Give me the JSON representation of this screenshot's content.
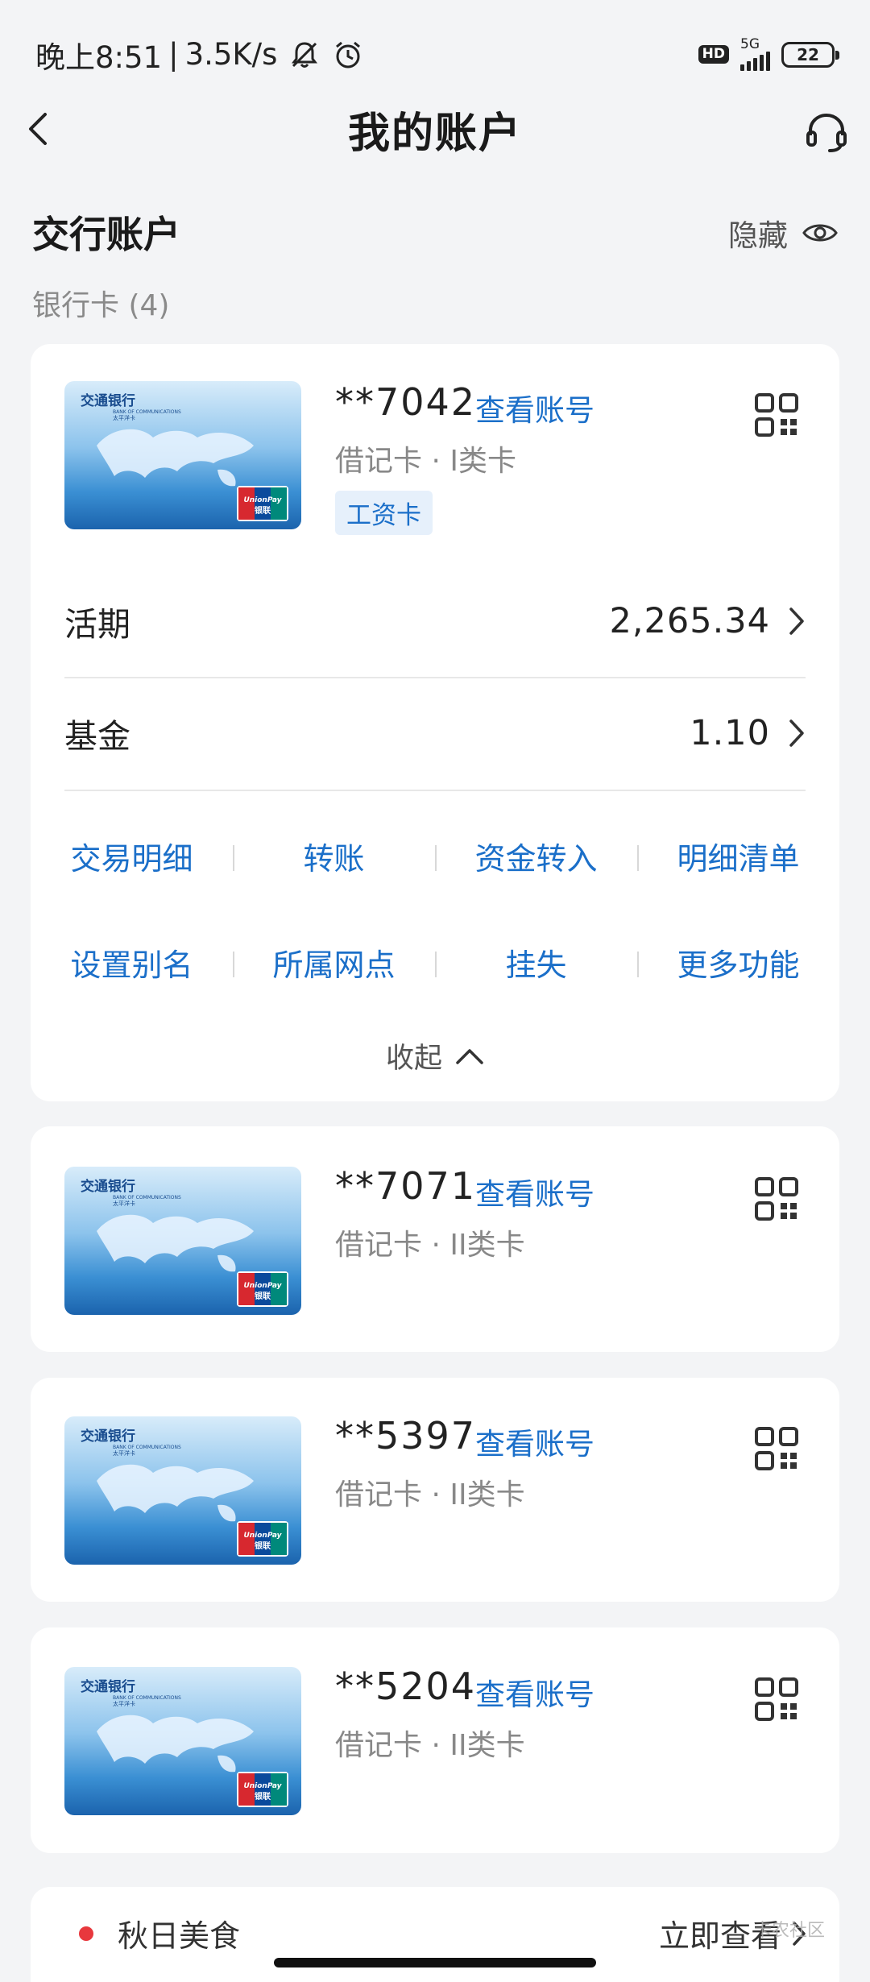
{
  "status_bar": {
    "time": "晚上8:51",
    "speed": "3.5K/s",
    "hd": "HD",
    "network": "5G",
    "battery": "22"
  },
  "header": {
    "title": "我的账户"
  },
  "section": {
    "title": "交行账户",
    "hide_label": "隐藏",
    "card_count": "银行卡 (4)"
  },
  "cards": [
    {
      "number": "**7042",
      "view_label": "查看账号",
      "type": "借记卡 · I类卡",
      "tag": "工资卡",
      "balances": [
        {
          "label": "活期",
          "value": "2,265.34"
        },
        {
          "label": "基金",
          "value": "1.10"
        }
      ],
      "actions_row1": [
        "交易明细",
        "转账",
        "资金转入",
        "明细清单"
      ],
      "actions_row2": [
        "设置别名",
        "所属网点",
        "挂失",
        "更多功能"
      ],
      "collapse_label": "收起"
    },
    {
      "number": "**7071",
      "view_label": "查看账号",
      "type": "借记卡 · II类卡"
    },
    {
      "number": "**5397",
      "view_label": "查看账号",
      "type": "借记卡 · II类卡"
    },
    {
      "number": "**5204",
      "view_label": "查看账号",
      "type": "借记卡 · II类卡"
    }
  ],
  "card_face": {
    "bank_name": "交通银行",
    "bank_name_en": "BANK OF COMMUNICATIONS",
    "sub": "太平洋卡",
    "unionpay": "UnionPay",
    "unionpay_cn": "银联"
  },
  "promo": {
    "label": "秋日美食",
    "link": "立即查看"
  },
  "watermark": "卡农社区",
  "colors": {
    "accent": "#1b6fc9",
    "background": "#f3f4f6",
    "promo_dot": "#e8383d"
  }
}
